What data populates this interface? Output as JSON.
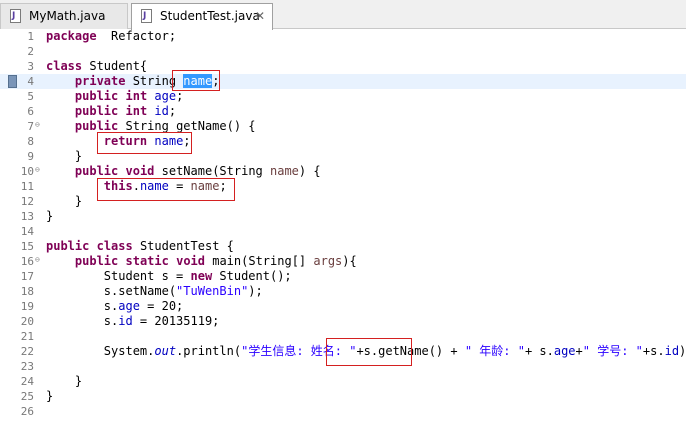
{
  "tabs": [
    {
      "label": "MyMath.java"
    },
    {
      "label": "StudentTest.java",
      "close": "✕"
    }
  ],
  "lines": [
    {
      "n": "1",
      "fold": "",
      "parts": [
        [
          "kw",
          "package"
        ],
        [
          "",
          "  Refactor;"
        ]
      ]
    },
    {
      "n": "2",
      "fold": "",
      "parts": []
    },
    {
      "n": "3",
      "fold": "",
      "parts": [
        [
          "kw",
          "class"
        ],
        [
          "",
          " Student{"
        ]
      ]
    },
    {
      "n": "4",
      "fold": "",
      "parts": [
        [
          "",
          "    "
        ],
        [
          "kw",
          "private"
        ],
        [
          "",
          " String "
        ],
        [
          "sel",
          "name"
        ],
        [
          "",
          ";"
        ]
      ]
    },
    {
      "n": "5",
      "fold": "",
      "parts": [
        [
          "",
          "    "
        ],
        [
          "kw",
          "public"
        ],
        [
          "",
          " "
        ],
        [
          "kw",
          "int"
        ],
        [
          "",
          " "
        ],
        [
          "fld",
          "age"
        ],
        [
          "",
          ";"
        ]
      ]
    },
    {
      "n": "6",
      "fold": "",
      "parts": [
        [
          "",
          "    "
        ],
        [
          "kw",
          "public"
        ],
        [
          "",
          " "
        ],
        [
          "kw",
          "int"
        ],
        [
          "",
          " "
        ],
        [
          "fld",
          "id"
        ],
        [
          "",
          ";"
        ]
      ]
    },
    {
      "n": "7",
      "fold": "⊖",
      "parts": [
        [
          "",
          "    "
        ],
        [
          "kw",
          "public"
        ],
        [
          "",
          " String getName() {"
        ]
      ]
    },
    {
      "n": "8",
      "fold": "",
      "parts": [
        [
          "",
          "        "
        ],
        [
          "kw",
          "return"
        ],
        [
          "",
          " "
        ],
        [
          "fld",
          "name"
        ],
        [
          "",
          ";"
        ]
      ]
    },
    {
      "n": "9",
      "fold": "",
      "parts": [
        [
          "",
          "    }"
        ]
      ]
    },
    {
      "n": "10",
      "fold": "⊖",
      "parts": [
        [
          "",
          "    "
        ],
        [
          "kw",
          "public"
        ],
        [
          "",
          " "
        ],
        [
          "kw",
          "void"
        ],
        [
          "",
          " setName(String "
        ],
        [
          "par",
          "name"
        ],
        [
          "",
          ") {"
        ]
      ]
    },
    {
      "n": "11",
      "fold": "",
      "parts": [
        [
          "",
          "        "
        ],
        [
          "kw",
          "this"
        ],
        [
          "",
          "."
        ],
        [
          "fld",
          "name"
        ],
        [
          "",
          " = "
        ],
        [
          "par",
          "name"
        ],
        [
          "",
          ";"
        ]
      ]
    },
    {
      "n": "12",
      "fold": "",
      "parts": [
        [
          "",
          "    }"
        ]
      ]
    },
    {
      "n": "13",
      "fold": "",
      "parts": [
        [
          "",
          "}"
        ]
      ]
    },
    {
      "n": "14",
      "fold": "",
      "parts": []
    },
    {
      "n": "15",
      "fold": "",
      "parts": [
        [
          "kw",
          "public"
        ],
        [
          "",
          " "
        ],
        [
          "kw",
          "class"
        ],
        [
          "",
          " StudentTest {"
        ]
      ]
    },
    {
      "n": "16",
      "fold": "⊖",
      "parts": [
        [
          "",
          "    "
        ],
        [
          "kw",
          "public"
        ],
        [
          "",
          " "
        ],
        [
          "kw",
          "static"
        ],
        [
          "",
          " "
        ],
        [
          "kw",
          "void"
        ],
        [
          "",
          " main(String[] "
        ],
        [
          "par",
          "args"
        ],
        [
          "",
          "){"
        ]
      ]
    },
    {
      "n": "17",
      "fold": "",
      "parts": [
        [
          "",
          "        Student s = "
        ],
        [
          "kw",
          "new"
        ],
        [
          "",
          " Student();"
        ]
      ]
    },
    {
      "n": "18",
      "fold": "",
      "parts": [
        [
          "",
          "        s.setName("
        ],
        [
          "str",
          "\"TuWenBin\""
        ],
        [
          "",
          ");"
        ]
      ]
    },
    {
      "n": "19",
      "fold": "",
      "parts": [
        [
          "",
          "        s."
        ],
        [
          "fld",
          "age"
        ],
        [
          "",
          " = 20;"
        ]
      ]
    },
    {
      "n": "20",
      "fold": "",
      "parts": [
        [
          "",
          "        s."
        ],
        [
          "fld",
          "id"
        ],
        [
          "",
          " = 20135119;"
        ]
      ]
    },
    {
      "n": "21",
      "fold": "",
      "parts": []
    },
    {
      "n": "22",
      "fold": "",
      "parts": [
        [
          "",
          "        System."
        ],
        [
          "stat",
          "out"
        ],
        [
          "",
          ".println("
        ],
        [
          "str",
          "\"学生信息: 姓名: \""
        ],
        [
          "",
          "+s.getName() + "
        ],
        [
          "str",
          "\" 年龄: \""
        ],
        [
          "",
          "+ s."
        ],
        [
          "fld",
          "age"
        ],
        [
          "",
          "+"
        ],
        [
          "str",
          "\" 学号: \""
        ],
        [
          "",
          "+s."
        ],
        [
          "fld",
          "id"
        ],
        [
          "",
          ");"
        ]
      ]
    },
    {
      "n": "23",
      "fold": "",
      "parts": []
    },
    {
      "n": "24",
      "fold": "",
      "parts": [
        [
          "",
          "    }"
        ]
      ]
    },
    {
      "n": "25",
      "fold": "",
      "parts": [
        [
          "",
          "}"
        ]
      ]
    },
    {
      "n": "26",
      "fold": "",
      "parts": []
    }
  ]
}
